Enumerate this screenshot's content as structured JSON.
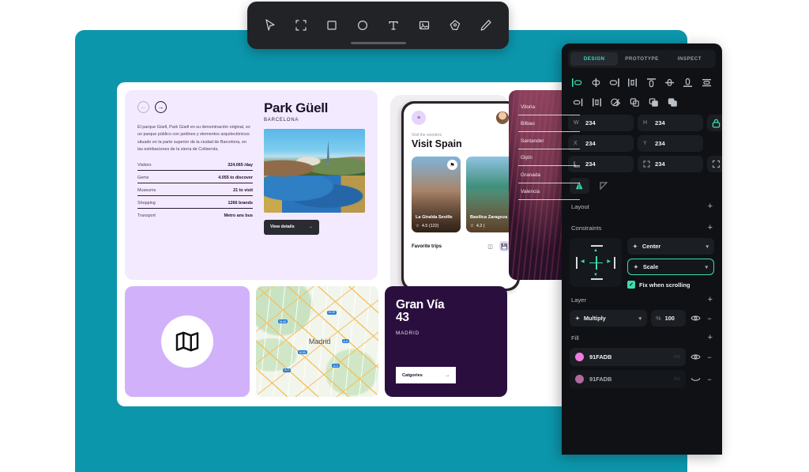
{
  "colors": {
    "teal_bg": "#0C96AC",
    "accent": "#3DDBB0",
    "panel_bg": "#0F1115",
    "info_bg": "#F4EAFF",
    "purple_card": "#D2B1FB",
    "granvia_bg": "#2A0F3E",
    "fill_swatch_1": "#F07BE0",
    "fill_swatch_2": "#B06A9E"
  },
  "toolbar": {
    "tools": [
      {
        "name": "cursor-tool",
        "icon": "cursor"
      },
      {
        "name": "frame-tool",
        "icon": "frame"
      },
      {
        "name": "rectangle-tool",
        "icon": "rectangle"
      },
      {
        "name": "ellipse-tool",
        "icon": "ellipse"
      },
      {
        "name": "text-tool",
        "icon": "text"
      },
      {
        "name": "image-tool",
        "icon": "image"
      },
      {
        "name": "pen-tool",
        "icon": "pen"
      },
      {
        "name": "pencil-tool",
        "icon": "pencil"
      }
    ]
  },
  "canvas": {
    "info_card": {
      "nav_back": "←",
      "nav_forward": "→",
      "description": "El parque Güell, Park Güell en su denominación original, es un parque público con jardines y elementos arquitectónicos situado en la parte superior de la ciudad de Barcelona, en las estribaciones de la sierra de Collserola.",
      "stats": [
        {
          "label": "Visitors",
          "value": "324.065 /day"
        },
        {
          "label": "Gems",
          "value": "4.055 to discover"
        },
        {
          "label": "Museums",
          "value": "21 to visit"
        },
        {
          "label": "Shopping",
          "value": "1266 brands"
        },
        {
          "label": "Transport",
          "value": "Metro ans bus"
        }
      ],
      "title": "Park Güell",
      "subtitle": "BARCELONA",
      "button_label": "View details",
      "button_arrow": "→"
    },
    "phone": {
      "menu_icon": "≡",
      "kicker": "Visit the wonders",
      "title": "Visit Spain",
      "cards": [
        {
          "name": "La Giralda Seville",
          "rating": "4.5 (122)",
          "badge": "⚑"
        },
        {
          "name": "Basílica Zaragoza",
          "rating": "4.2 (",
          "badge": ""
        }
      ],
      "footer_title": "Favorite trips",
      "footer_icons": [
        "columns-icon",
        "save-icon"
      ]
    },
    "city_list": {
      "items": [
        "Vitoria",
        "Bilbao",
        "Santander",
        "Gijón",
        "Granada",
        "Valencia"
      ]
    },
    "map_card": {
      "label": "Madrid",
      "shields": [
        "M-40",
        "M-30",
        "M-50",
        "A-6",
        "A-2",
        "A-3",
        "A-42",
        "R-5"
      ]
    },
    "granvia_card": {
      "title_line1": "Gran Vía",
      "title_line2": "43",
      "subtitle": "MADRID",
      "button_label": "Catgories",
      "button_arrow": "→"
    },
    "map_icon_card": {
      "icon": "map-icon"
    }
  },
  "inspector": {
    "tabs": [
      {
        "label": "DESIGN",
        "active": true
      },
      {
        "label": "PROTOTYPE",
        "active": false
      },
      {
        "label": "INSPECT",
        "active": false
      }
    ],
    "align_icons": [
      "align-left-icon",
      "align-horizontal-center-icon",
      "align-right-icon",
      "distribute-vertical-icon",
      "align-top-icon",
      "align-vertical-center-icon",
      "align-bottom-icon",
      "distribute-horizontal-icon"
    ],
    "boolean_icons": [
      "align-right-edge-icon",
      "distribute-centers-icon",
      "mask-icon",
      "union-icon",
      "subtract-icon",
      "intersect-icon"
    ],
    "fields": [
      {
        "key": "W",
        "value": "234"
      },
      {
        "key": "H",
        "value": "234"
      },
      {
        "key": "X",
        "value": "234"
      },
      {
        "key": "Y",
        "value": "234"
      },
      {
        "key": "angle",
        "value": "234"
      },
      {
        "key": "corner-radius",
        "value": "234"
      }
    ],
    "lock_icon": "lock-icon",
    "independent_corners_icon": "independent-corners-icon",
    "flip_icons": [
      "flip-horizontal-icon",
      "flip-vertical-icon"
    ],
    "layout": {
      "title": "Layout",
      "add": "+"
    },
    "constraints": {
      "title": "Constraints",
      "add": "+",
      "horizontal": "Center",
      "vertical": "Scale",
      "fix_when_scrolling": "Fix when scrolling",
      "fix_checked": true
    },
    "layer": {
      "title": "Layer",
      "add": "+",
      "blend_mode": "Multiply",
      "opacity_symbol": "%",
      "opacity": "100"
    },
    "fill": {
      "title": "Fill",
      "add": "+",
      "items": [
        {
          "hex": "91FADB",
          "swatch": "#F07BE0",
          "visible": true
        },
        {
          "hex": "91FADB",
          "swatch": "#B06A9E",
          "visible": false
        }
      ]
    }
  }
}
